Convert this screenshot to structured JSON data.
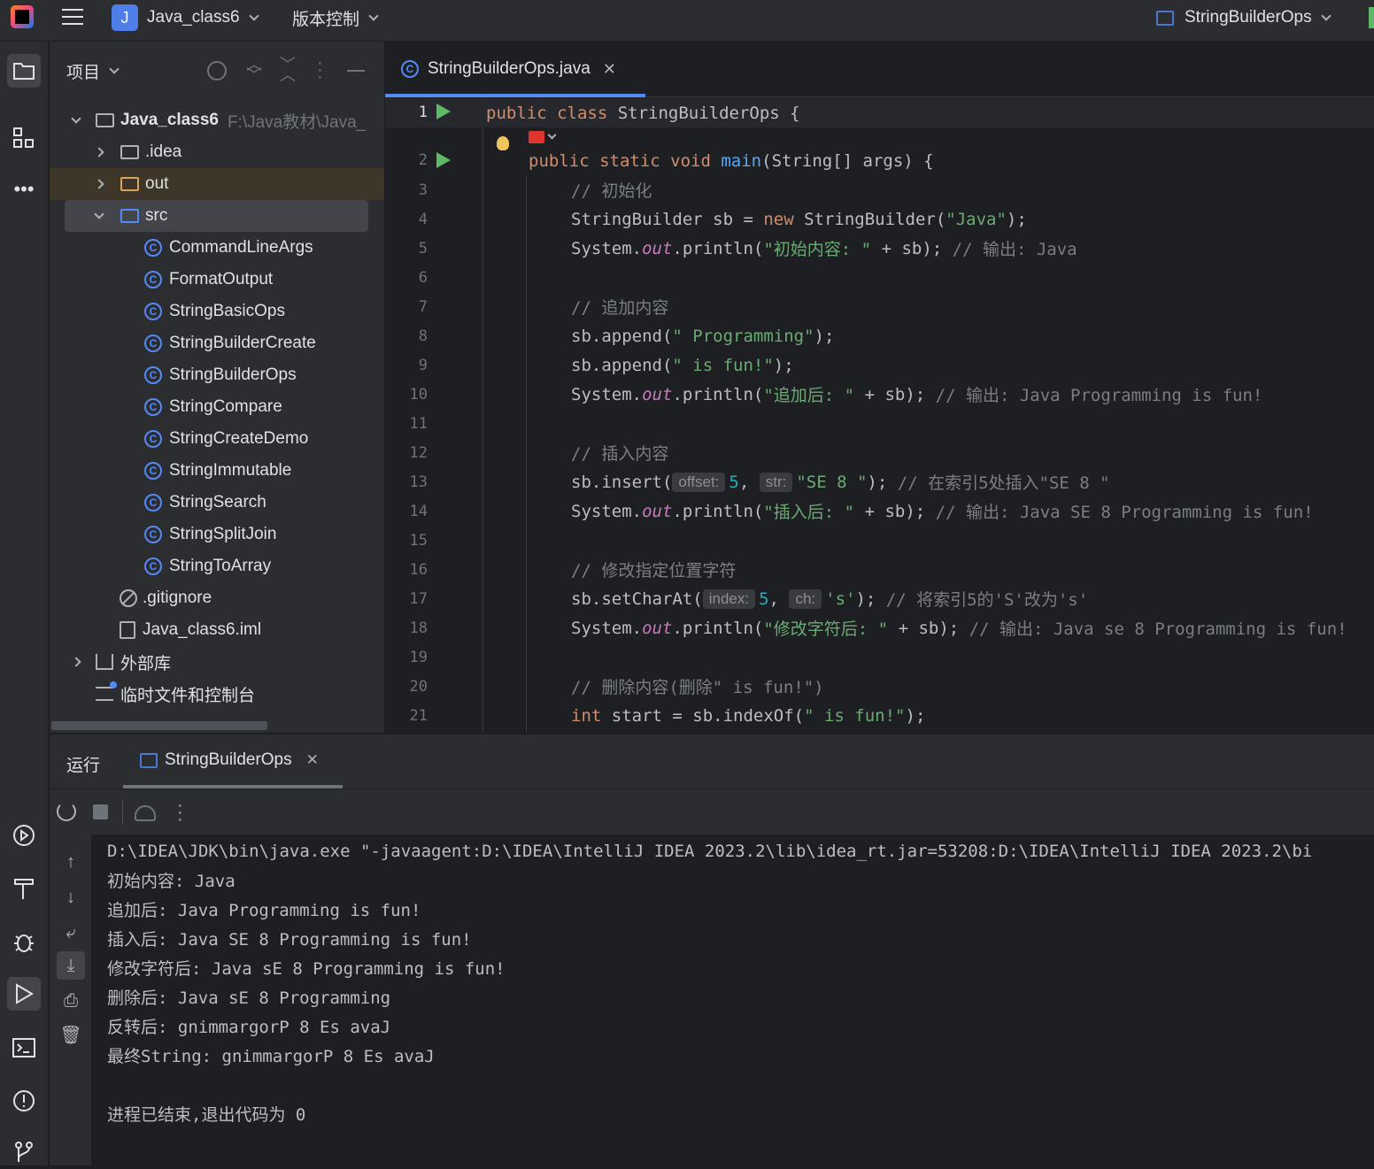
{
  "titlebar": {
    "project_badge": "J",
    "project_name": "Java_class6",
    "vcs_label": "版本控制",
    "run_config": "StringBuilderOps"
  },
  "project_panel": {
    "title": "项目",
    "root": {
      "name": "Java_class6",
      "path": "F:\\Java教材\\Java_"
    },
    "items": [
      {
        "label": ".idea"
      },
      {
        "label": "out"
      },
      {
        "label": "src"
      },
      {
        "label": "CommandLineArgs"
      },
      {
        "label": "FormatOutput"
      },
      {
        "label": "StringBasicOps"
      },
      {
        "label": "StringBuilderCreate"
      },
      {
        "label": "StringBuilderOps"
      },
      {
        "label": "StringCompare"
      },
      {
        "label": "StringCreateDemo"
      },
      {
        "label": "StringImmutable"
      },
      {
        "label": "StringSearch"
      },
      {
        "label": "StringSplitJoin"
      },
      {
        "label": "StringToArray"
      },
      {
        "label": ".gitignore"
      },
      {
        "label": "Java_class6.iml"
      },
      {
        "label": "外部库"
      },
      {
        "label": "临时文件和控制台"
      }
    ]
  },
  "editor": {
    "tab_label": "StringBuilderOps.java",
    "line_numbers": [
      "1",
      "2",
      "3",
      "4",
      "5",
      "6",
      "7",
      "8",
      "9",
      "10",
      "11",
      "12",
      "13",
      "14",
      "15",
      "16",
      "17",
      "18",
      "19",
      "20",
      "21"
    ],
    "hints": {
      "offset": "offset:",
      "str": "str:",
      "index": "index:",
      "ch": "ch:"
    },
    "code": {
      "l1_kw": "public class",
      "l1_rest": " StringBuilderOps {",
      "l2_kw": "public static void",
      "l2_fn": "main",
      "l2_rest": "(String[] args) {",
      "l3_cm": "// 初始化",
      "l4_a": "StringBuilder sb = ",
      "l4_kw": "new",
      "l4_b": " StringBuilder(",
      "l4_str": "\"Java\"",
      "l4_c": ");",
      "l5_a": "System.",
      "l5_out": "out",
      "l5_b": ".println(",
      "l5_str": "\"初始内容: \"",
      "l5_c": " + sb); ",
      "l5_cm": "// 输出: Java",
      "l7_cm": "// 追加内容",
      "l8_a": "sb.append(",
      "l8_str": "\" Programming\"",
      "l8_b": ");",
      "l9_a": "sb.append(",
      "l9_str": "\" is fun!\"",
      "l9_b": ");",
      "l10_a": "System.",
      "l10_out": "out",
      "l10_b": ".println(",
      "l10_str": "\"追加后: \"",
      "l10_c": " + sb); ",
      "l10_cm": "// 输出: Java Programming is fun!",
      "l12_cm": "// 插入内容",
      "l13_a": "sb.insert(",
      "l13_num": "5",
      "l13_b": ", ",
      "l13_str": "\"SE 8 \"",
      "l13_c": "); ",
      "l13_cm": "// 在索引5处插入\"SE 8 \"",
      "l14_a": "System.",
      "l14_out": "out",
      "l14_b": ".println(",
      "l14_str": "\"插入后: \"",
      "l14_c": " + sb); ",
      "l14_cm": "// 输出: Java SE 8 Programming is fun!",
      "l16_cm": "// 修改指定位置字符",
      "l17_a": "sb.setCharAt(",
      "l17_num": "5",
      "l17_b": ", ",
      "l17_str": "'s'",
      "l17_c": "); ",
      "l17_cm": "// 将索引5的'S'改为's'",
      "l18_a": "System.",
      "l18_out": "out",
      "l18_b": ".println(",
      "l18_str": "\"修改字符后: \"",
      "l18_c": " + sb); ",
      "l18_cm": "// 输出: Java se 8 Programming is fun!",
      "l20_cm": "// 删除内容(删除\" is fun!\")",
      "l21_kw": "int",
      "l21_a": " start = sb.indexOf(",
      "l21_str": "\" is fun!\"",
      "l21_b": ");"
    }
  },
  "run_panel": {
    "title": "运行",
    "tab_label": "StringBuilderOps",
    "console_lines": [
      "D:\\IDEA\\JDK\\bin\\java.exe \"-javaagent:D:\\IDEA\\IntelliJ IDEA 2023.2\\lib\\idea_rt.jar=53208:D:\\IDEA\\IntelliJ IDEA 2023.2\\bi",
      "初始内容: Java",
      "追加后: Java Programming is fun!",
      "插入后: Java SE 8 Programming is fun!",
      "修改字符后: Java sE 8 Programming is fun!",
      "删除后: Java sE 8 Programming",
      "反转后: gnimmargorP 8 Es avaJ",
      "最终String: gnimmargorP 8 Es avaJ",
      "",
      "进程已结束,退出代码为 0"
    ]
  },
  "colors": {
    "accent": "#548af7",
    "bg": "#1e1f22",
    "panel": "#2b2d30"
  }
}
